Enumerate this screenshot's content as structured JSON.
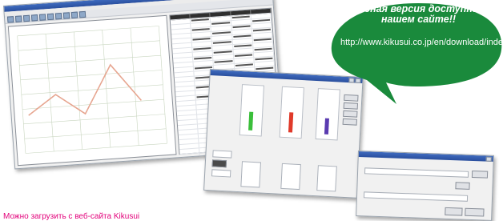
{
  "promo": {
    "title": "Пробная версия доступна на нашем сайте!!",
    "url": "http://www.kikusui.co.jp/en/download/index.html"
  },
  "caption": "Можно загрузить с веб-сайта Kikusui",
  "colors": {
    "bubble_green": "#1a8a3c",
    "caption_magenta": "#e2007a",
    "trend_line": "#e7a691",
    "meter_green": "#3bbf3b",
    "meter_red": "#e03a2a",
    "meter_purple": "#5a3bb0"
  },
  "trend_chart": {
    "values": [
      32,
      48,
      30,
      70,
      38
    ]
  },
  "meters": {
    "levels": [
      0.45,
      0.5,
      0.4
    ]
  }
}
